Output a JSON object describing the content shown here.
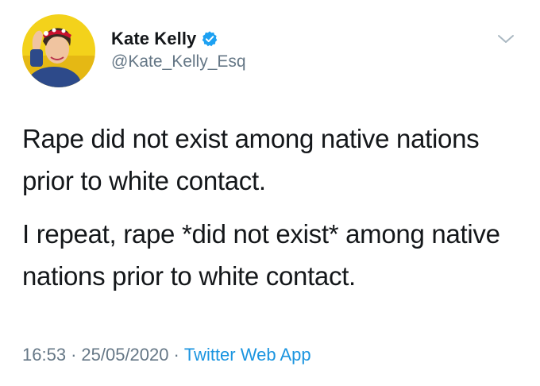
{
  "tweet": {
    "author": {
      "display_name": "Kate Kelly",
      "handle": "@Kate_Kelly_Esq",
      "verified": true,
      "avatar_icon": "avatar-photo",
      "verified_icon": "verified-badge-icon"
    },
    "menu_icon": "chevron-down-icon",
    "paragraphs": [
      "Rape did not exist among native nations prior to white contact.",
      "I repeat, rape *did not exist* among native nations prior to white contact."
    ],
    "time": "16:53",
    "date": "25/05/2020",
    "separator": "·",
    "source": "Twitter Web App"
  },
  "colors": {
    "text": "#14171a",
    "secondary": "#657786",
    "link": "#1b95e0",
    "verified": "#1da1f2",
    "background": "#ffffff"
  }
}
